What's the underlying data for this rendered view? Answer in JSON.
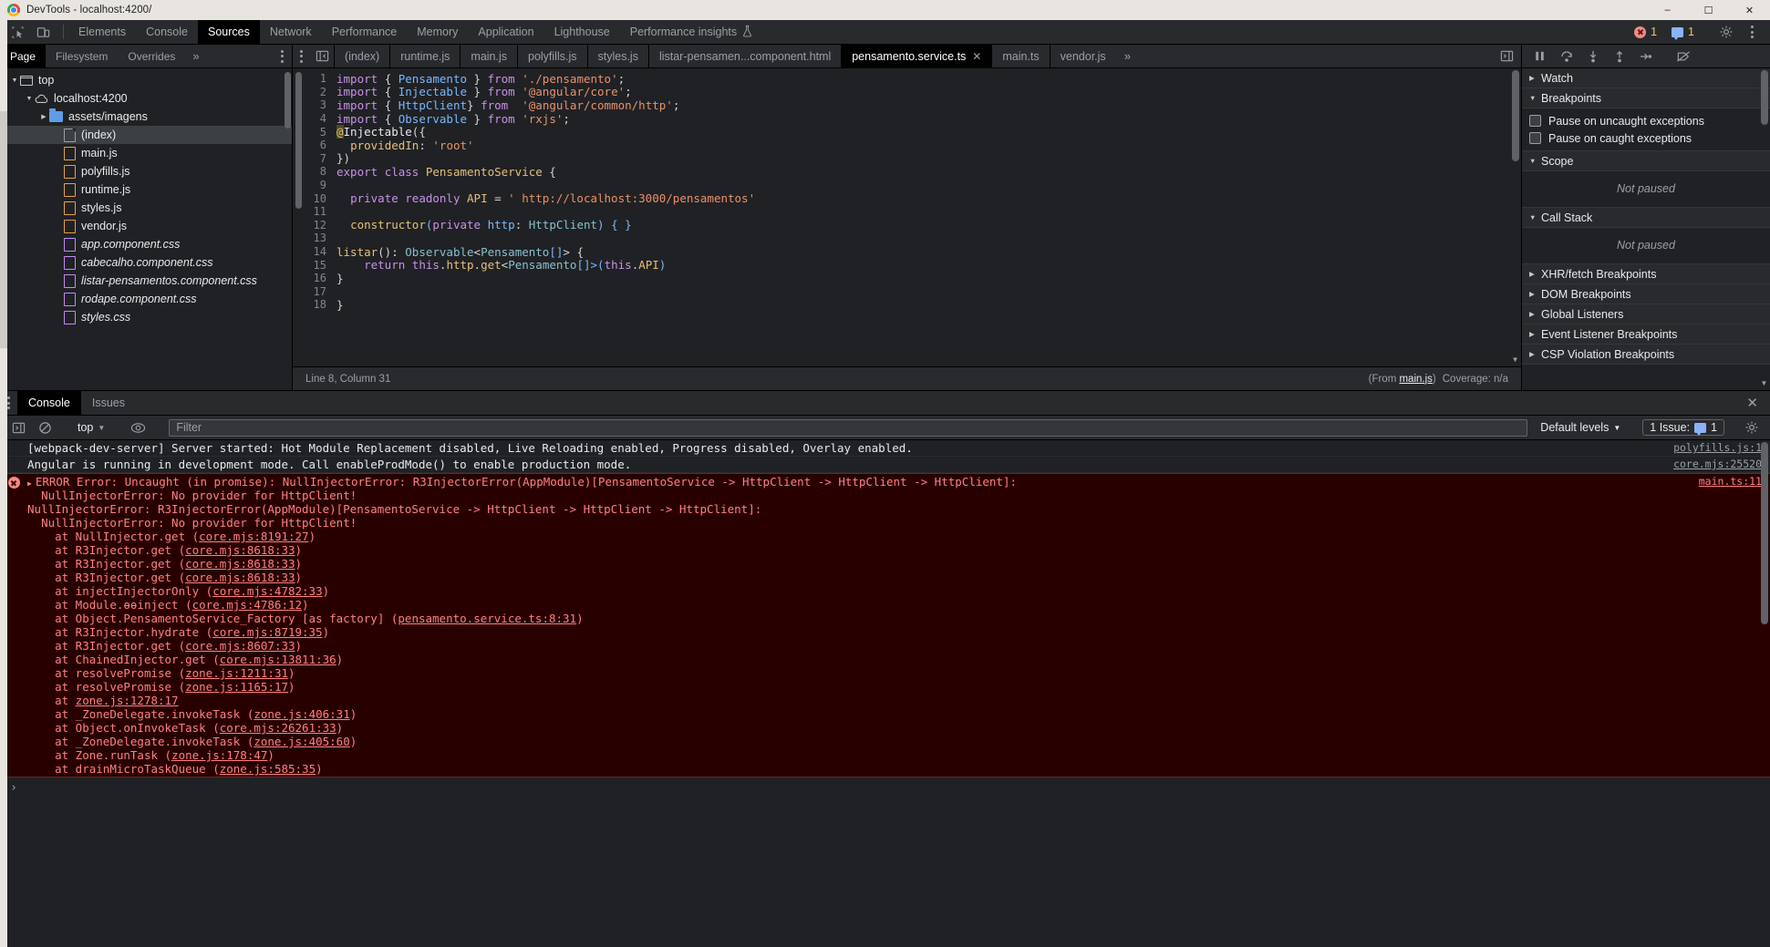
{
  "window": {
    "title": "DevTools - localhost:4200/",
    "minimize": "–",
    "maximize": "☐",
    "close": "✕"
  },
  "main_tabs": {
    "items": [
      {
        "label": "Elements",
        "active": false
      },
      {
        "label": "Console",
        "active": false
      },
      {
        "label": "Sources",
        "active": true
      },
      {
        "label": "Network",
        "active": false
      },
      {
        "label": "Performance",
        "active": false
      },
      {
        "label": "Memory",
        "active": false
      },
      {
        "label": "Application",
        "active": false
      },
      {
        "label": "Lighthouse",
        "active": false
      },
      {
        "label": "Performance insights",
        "active": false
      }
    ],
    "inspect_icon": "inspect-element-icon",
    "device_icon": "device-toolbar-icon",
    "flask_icon": "experiment-flask-icon",
    "error_count": "1",
    "warning_count": "1",
    "settings_icon": "gear-icon",
    "more_icon": "kebab-menu-icon"
  },
  "navigator": {
    "tabs": [
      {
        "label": "Page",
        "active": true
      },
      {
        "label": "Filesystem",
        "active": false
      },
      {
        "label": "Overrides",
        "active": false
      }
    ],
    "more_chevron": "»",
    "tree": [
      {
        "label": "top",
        "indent": 0,
        "icon": "frame",
        "triangle": "▼",
        "selected": false,
        "italic": false
      },
      {
        "label": "localhost:4200",
        "indent": 1,
        "icon": "cloud",
        "triangle": "▼",
        "selected": false,
        "italic": false
      },
      {
        "label": "assets/imagens",
        "indent": 2,
        "icon": "folder",
        "triangle": "▶",
        "selected": false,
        "italic": false
      },
      {
        "label": "(index)",
        "indent": 3,
        "icon": "doc",
        "triangle": "",
        "selected": true,
        "italic": false
      },
      {
        "label": "main.js",
        "indent": 3,
        "icon": "js",
        "triangle": "",
        "selected": false,
        "italic": false
      },
      {
        "label": "polyfills.js",
        "indent": 3,
        "icon": "js",
        "triangle": "",
        "selected": false,
        "italic": false
      },
      {
        "label": "runtime.js",
        "indent": 3,
        "icon": "js",
        "triangle": "",
        "selected": false,
        "italic": false
      },
      {
        "label": "styles.js",
        "indent": 3,
        "icon": "js",
        "triangle": "",
        "selected": false,
        "italic": false
      },
      {
        "label": "vendor.js",
        "indent": 3,
        "icon": "js",
        "triangle": "",
        "selected": false,
        "italic": false
      },
      {
        "label": "app.component.css",
        "indent": 3,
        "icon": "css",
        "triangle": "",
        "selected": false,
        "italic": true
      },
      {
        "label": "cabecalho.component.css",
        "indent": 3,
        "icon": "css",
        "triangle": "",
        "selected": false,
        "italic": true
      },
      {
        "label": "listar-pensamentos.component.css",
        "indent": 3,
        "icon": "css",
        "triangle": "",
        "selected": false,
        "italic": true
      },
      {
        "label": "rodape.component.css",
        "indent": 3,
        "icon": "css",
        "triangle": "",
        "selected": false,
        "italic": true
      },
      {
        "label": "styles.css",
        "indent": 3,
        "icon": "css",
        "triangle": "",
        "selected": false,
        "italic": true
      }
    ]
  },
  "editor": {
    "tabs": [
      {
        "label": "(index)",
        "active": false,
        "closable": false
      },
      {
        "label": "runtime.js",
        "active": false,
        "closable": false
      },
      {
        "label": "main.js",
        "active": false,
        "closable": false
      },
      {
        "label": "polyfills.js",
        "active": false,
        "closable": false
      },
      {
        "label": "styles.js",
        "active": false,
        "closable": false
      },
      {
        "label": "listar-pensamen...component.html",
        "active": false,
        "closable": false
      },
      {
        "label": "pensamento.service.ts",
        "active": true,
        "closable": true
      },
      {
        "label": "main.ts",
        "active": false,
        "closable": false
      },
      {
        "label": "vendor.js",
        "active": false,
        "closable": false
      }
    ],
    "overflow": "»",
    "close_glyph": "✕",
    "show_navigator_icon": "show-navigator-icon",
    "toggle_panel_icon": "toggle-panel-icon",
    "code_lines": [
      {
        "no": "1",
        "tokens": [
          {
            "t": "import ",
            "c": "k"
          },
          {
            "t": "{ ",
            "c": "p"
          },
          {
            "t": "Pensamento",
            "c": "b"
          },
          {
            "t": " } ",
            "c": "p"
          },
          {
            "t": "from ",
            "c": "k"
          },
          {
            "t": "'./pensamento'",
            "c": "s"
          },
          {
            "t": ";",
            "c": "p"
          }
        ]
      },
      {
        "no": "2",
        "tokens": [
          {
            "t": "import ",
            "c": "k"
          },
          {
            "t": "{ ",
            "c": "p"
          },
          {
            "t": "Injectable",
            "c": "b"
          },
          {
            "t": " } ",
            "c": "p"
          },
          {
            "t": "from ",
            "c": "k"
          },
          {
            "t": "'@angular/core'",
            "c": "s"
          },
          {
            "t": ";",
            "c": "p"
          }
        ]
      },
      {
        "no": "3",
        "tokens": [
          {
            "t": "import ",
            "c": "k"
          },
          {
            "t": "{ ",
            "c": "p"
          },
          {
            "t": "HttpClient",
            "c": "b"
          },
          {
            "t": "} ",
            "c": "p"
          },
          {
            "t": "from ",
            "c": "k"
          },
          {
            "t": " '@angular/common/http'",
            "c": "s"
          },
          {
            "t": ";",
            "c": "p"
          }
        ]
      },
      {
        "no": "4",
        "tokens": [
          {
            "t": "import ",
            "c": "k"
          },
          {
            "t": "{ ",
            "c": "p"
          },
          {
            "t": "Observable",
            "c": "b"
          },
          {
            "t": " } ",
            "c": "p"
          },
          {
            "t": "from ",
            "c": "k"
          },
          {
            "t": "'rxjs'",
            "c": "s"
          },
          {
            "t": ";",
            "c": "p"
          }
        ]
      },
      {
        "no": "5",
        "tokens": [
          {
            "t": "@",
            "c": "dec"
          },
          {
            "t": "Injectable",
            "c": "ctxt"
          },
          {
            "t": "({",
            "c": "p"
          }
        ]
      },
      {
        "no": "6",
        "tokens": [
          {
            "t": "  ",
            "c": "p"
          },
          {
            "t": "providedIn",
            "c": "y"
          },
          {
            "t": ": ",
            "c": "p"
          },
          {
            "t": "'root'",
            "c": "s"
          }
        ]
      },
      {
        "no": "7",
        "tokens": [
          {
            "t": "})",
            "c": "p"
          }
        ]
      },
      {
        "no": "8",
        "tokens": [
          {
            "t": "export ",
            "c": "k"
          },
          {
            "t": "class ",
            "c": "k"
          },
          {
            "t": "PensamentoService",
            "c": "y"
          },
          {
            "t": " {",
            "c": "p"
          }
        ]
      },
      {
        "no": "9",
        "tokens": []
      },
      {
        "no": "10",
        "tokens": [
          {
            "t": "  ",
            "c": "p"
          },
          {
            "t": "private ",
            "c": "k"
          },
          {
            "t": "readonly ",
            "c": "k"
          },
          {
            "t": "API",
            "c": "y"
          },
          {
            "t": " = ",
            "c": "p"
          },
          {
            "t": "' http://localhost:3000/pensamentos'",
            "c": "s"
          }
        ]
      },
      {
        "no": "11",
        "tokens": []
      },
      {
        "no": "12",
        "tokens": [
          {
            "t": "  ",
            "c": "p"
          },
          {
            "t": "constructor",
            "c": "y"
          },
          {
            "t": "(",
            "c": "b"
          },
          {
            "t": "private ",
            "c": "k"
          },
          {
            "t": "http",
            "c": "b"
          },
          {
            "t": ": ",
            "c": "p"
          },
          {
            "t": "HttpClient",
            "c": "n"
          },
          {
            "t": ") { }",
            "c": "b"
          }
        ]
      },
      {
        "no": "13",
        "tokens": []
      },
      {
        "no": "14",
        "tokens": [
          {
            "t": "listar",
            "c": "y"
          },
          {
            "t": "(): ",
            "c": "p"
          },
          {
            "t": "Observable",
            "c": "n"
          },
          {
            "t": "<",
            "c": "p"
          },
          {
            "t": "Pensamento",
            "c": "n"
          },
          {
            "t": "[]",
            "c": "b"
          },
          {
            "t": "> {",
            "c": "p"
          }
        ]
      },
      {
        "no": "15",
        "tokens": [
          {
            "t": "    ",
            "c": "p"
          },
          {
            "t": "return ",
            "c": "k"
          },
          {
            "t": "this",
            "c": "k"
          },
          {
            "t": ".",
            "c": "p"
          },
          {
            "t": "http",
            "c": "y"
          },
          {
            "t": ".",
            "c": "p"
          },
          {
            "t": "get",
            "c": "y"
          },
          {
            "t": "<",
            "c": "p"
          },
          {
            "t": "Pensamento",
            "c": "n"
          },
          {
            "t": "[]",
            "c": "b"
          },
          {
            "t": ">(",
            "c": "b"
          },
          {
            "t": "this",
            "c": "k"
          },
          {
            "t": ".",
            "c": "p"
          },
          {
            "t": "API",
            "c": "y"
          },
          {
            "t": ")",
            "c": "b"
          }
        ]
      },
      {
        "no": "16",
        "tokens": [
          {
            "t": "}",
            "c": "p"
          }
        ]
      },
      {
        "no": "17",
        "tokens": []
      },
      {
        "no": "18",
        "tokens": [
          {
            "t": "}",
            "c": "p"
          }
        ]
      }
    ],
    "status_left": "Line 8, Column 31",
    "status_from_prefix": "(From ",
    "status_from_link": "main.js",
    "status_from_suffix": ")",
    "status_coverage": "Coverage: n/a"
  },
  "debugger": {
    "toolbar_icons": [
      {
        "name": "pause-resume-script-icon"
      },
      {
        "name": "step-over-icon"
      },
      {
        "name": "step-into-icon"
      },
      {
        "name": "step-out-icon"
      },
      {
        "name": "step-icon"
      },
      {
        "name": "deactivate-breakpoints-icon"
      }
    ],
    "sections": [
      {
        "title": "Watch",
        "triangle": "▶",
        "expanded": false
      },
      {
        "title": "Breakpoints",
        "triangle": "▼",
        "expanded": true
      },
      {
        "title": "Scope",
        "triangle": "▼",
        "expanded": true
      },
      {
        "title": "Call Stack",
        "triangle": "▼",
        "expanded": true
      },
      {
        "title": "XHR/fetch Breakpoints",
        "triangle": "▶",
        "expanded": false
      },
      {
        "title": "DOM Breakpoints",
        "triangle": "▶",
        "expanded": false
      },
      {
        "title": "Global Listeners",
        "triangle": "▶",
        "expanded": false
      },
      {
        "title": "Event Listener Breakpoints",
        "triangle": "▶",
        "expanded": false
      },
      {
        "title": "CSP Violation Breakpoints",
        "triangle": "▶",
        "expanded": false
      }
    ],
    "pause_uncaught": "Pause on uncaught exceptions",
    "pause_caught": "Pause on caught exceptions",
    "scope_empty": "Not paused",
    "callstack_empty": "Not paused"
  },
  "drawer": {
    "tabs": [
      {
        "label": "Console",
        "active": true
      },
      {
        "label": "Issues",
        "active": false
      }
    ],
    "close_glyph": "✕",
    "sidebar_icon": "console-sidebar-icon",
    "clear_icon": "clear-console-icon",
    "context": "top",
    "context_caret": "▼",
    "eye_icon": "live-expression-icon",
    "filter_placeholder": "Filter",
    "levels_label": "Default levels",
    "levels_caret": "▼",
    "issues_label": "1 Issue:",
    "issues_count": "1",
    "settings_icon": "gear-icon",
    "prompt_caret": "›",
    "messages": [
      {
        "type": "log",
        "text": "[webpack-dev-server] Server started: Hot Module Replacement disabled, Live Reloading enabled, Progress disabled, Overlay enabled.",
        "source": "polyfills.js:1"
      },
      {
        "type": "log",
        "text": "Angular is running in development mode. Call enableProdMode() to enable production mode.",
        "source": "core.mjs:25520"
      },
      {
        "type": "error",
        "source": "main.ts:11",
        "lines": [
          "ERROR Error: Uncaught (in promise): NullInjectorError: R3InjectorError(AppModule)[PensamentoService -> HttpClient -> HttpClient -> HttpClient]:",
          "  NullInjectorError: No provider for HttpClient!",
          "NullInjectorError: R3InjectorError(AppModule)[PensamentoService -> HttpClient -> HttpClient -> HttpClient]:",
          "  NullInjectorError: No provider for HttpClient!"
        ],
        "stack": [
          {
            "pre": "    at NullInjector.get (",
            "link": "core.mjs:8191:27",
            "post": ")"
          },
          {
            "pre": "    at R3Injector.get (",
            "link": "core.mjs:8618:33",
            "post": ")"
          },
          {
            "pre": "    at R3Injector.get (",
            "link": "core.mjs:8618:33",
            "post": ")"
          },
          {
            "pre": "    at R3Injector.get (",
            "link": "core.mjs:8618:33",
            "post": ")"
          },
          {
            "pre": "    at injectInjectorOnly (",
            "link": "core.mjs:4782:33",
            "post": ")"
          },
          {
            "pre": "    at Module.ɵɵinject (",
            "link": "core.mjs:4786:12",
            "post": ")"
          },
          {
            "pre": "    at Object.PensamentoService_Factory [as factory] (",
            "link": "pensamento.service.ts:8:31",
            "post": ")"
          },
          {
            "pre": "    at R3Injector.hydrate (",
            "link": "core.mjs:8719:35",
            "post": ")"
          },
          {
            "pre": "    at R3Injector.get (",
            "link": "core.mjs:8607:33",
            "post": ")"
          },
          {
            "pre": "    at ChainedInjector.get (",
            "link": "core.mjs:13811:36",
            "post": ")"
          },
          {
            "pre": "    at resolvePromise (",
            "link": "zone.js:1211:31",
            "post": ")"
          },
          {
            "pre": "    at resolvePromise (",
            "link": "zone.js:1165:17",
            "post": ")"
          },
          {
            "pre": "    at ",
            "link": "zone.js:1278:17",
            "post": ""
          },
          {
            "pre": "    at _ZoneDelegate.invokeTask (",
            "link": "zone.js:406:31",
            "post": ")"
          },
          {
            "pre": "    at Object.onInvokeTask (",
            "link": "core.mjs:26261:33",
            "post": ")"
          },
          {
            "pre": "    at _ZoneDelegate.invokeTask (",
            "link": "zone.js:405:60",
            "post": ")"
          },
          {
            "pre": "    at Zone.runTask (",
            "link": "zone.js:178:47",
            "post": ")"
          },
          {
            "pre": "    at drainMicroTaskQueue (",
            "link": "zone.js:585:35",
            "post": ")"
          }
        ]
      }
    ]
  },
  "colors": {
    "accent_blue": "#8ab4f8",
    "error_red": "#ff8080",
    "error_bg": "#290000",
    "panel_bg": "#202124",
    "toolbar_bg": "#292a2d",
    "warning_yellow": "#f3c969"
  }
}
